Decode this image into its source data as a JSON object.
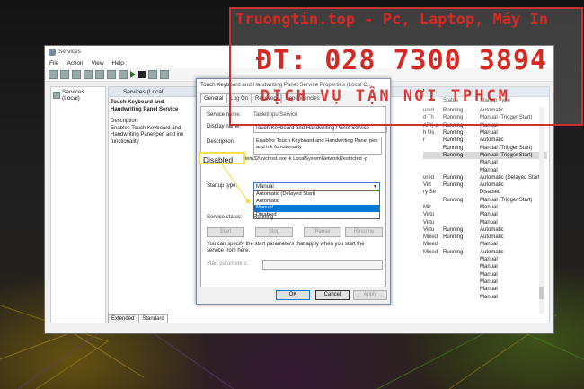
{
  "window": {
    "title": "Services",
    "menu": [
      "File",
      "Action",
      "View",
      "Help"
    ]
  },
  "tree": {
    "root": "Services (Local)"
  },
  "panel": {
    "header": "Services (Local)",
    "service_title": "Touch Keyboard and Handwriting Panel Service",
    "description_label": "Description:",
    "description_text": "Enables Touch Keyboard and Handwriting Panel pen and ink functionality"
  },
  "list": {
    "columns": {
      "status": "Status",
      "startup": "Startup Type"
    },
    "rows": [
      {
        "prefix": "",
        "status": "Running",
        "startup": "Automatic"
      },
      {
        "prefix": "",
        "status": "Running",
        "startup": "Manual (Trigger Start)"
      },
      {
        "prefix": "",
        "status": "Running",
        "startup": "Manual"
      },
      {
        "prefix": "",
        "status": "Running",
        "startup": "Manual"
      },
      {
        "prefix": "",
        "status": "Running",
        "startup": "Automatic"
      },
      {
        "prefix": "",
        "status": "Running",
        "startup": "Manual (Trigger Start)"
      },
      {
        "prefix": "",
        "status": "Running",
        "startup": "Manual (Trigger Start)"
      },
      {
        "prefix": "",
        "status": "",
        "startup": "Manual"
      },
      {
        "prefix": "",
        "status": "",
        "startup": "Manual"
      },
      {
        "prefix": "",
        "status": "Running",
        "startup": "Automatic (Delayed Start)"
      },
      {
        "prefix": "",
        "status": "Running",
        "startup": "Automatic"
      },
      {
        "prefix": "",
        "status": "",
        "startup": "Disabled"
      },
      {
        "prefix": "",
        "status": "Running",
        "startup": "Manual (Trigger Start)"
      },
      {
        "prefix": "",
        "status": "",
        "startup": "Manual"
      },
      {
        "prefix": "",
        "status": "",
        "startup": "Manual"
      },
      {
        "prefix": "",
        "status": "",
        "startup": "Manual"
      },
      {
        "prefix": "",
        "status": "Running",
        "startup": "Automatic"
      },
      {
        "prefix": "",
        "status": "Running",
        "startup": "Automatic"
      },
      {
        "prefix": "",
        "status": "",
        "startup": "Manual"
      },
      {
        "prefix": "",
        "status": "Running",
        "startup": "Automatic"
      },
      {
        "prefix": "",
        "status": "",
        "startup": "Manual"
      },
      {
        "prefix": "",
        "status": "",
        "startup": "Manual"
      },
      {
        "prefix": "",
        "status": "",
        "startup": "Manual"
      },
      {
        "prefix": "",
        "status": "",
        "startup": "Manual"
      },
      {
        "prefix": "",
        "status": "",
        "startup": "Manual"
      },
      {
        "prefix": "",
        "status": "",
        "startup": "Manual"
      }
    ],
    "prefixes_top": [
      "ured",
      "d Th",
      "API) s",
      "h Us",
      "r",
      "",
      "",
      "",
      "",
      "ured",
      "Virt",
      "ry Se",
      "",
      "Mic",
      "Virtu",
      "Virtu",
      "Virtu",
      "Mixed",
      "Mixed",
      "Mixed",
      "",
      "",
      "",
      "",
      "",
      ""
    ]
  },
  "bottom_tabs": [
    "Extended",
    "Standard"
  ],
  "dialog": {
    "title": "Touch Keyboard and Handwriting Panel Service Properties (Local C...",
    "tabs": [
      "General",
      "Log On",
      "Recovery",
      "Dependencies"
    ],
    "service_name_label": "Service name:",
    "service_name": "TabletInputService",
    "display_name_label": "Display name:",
    "display_name": "Touch Keyboard and Handwriting Panel Service",
    "description_label": "Description:",
    "description": "Enables Touch Keyboard and Handwriting Panel pen and ink functionality",
    "path": "C:\\Wi  DOWS\\System32\\svchost.exe -k LocalSystemNetworkRestricted -p",
    "startup_label": "Startup type:",
    "startup_value": "Manual",
    "startup_options": [
      "Automatic (Delayed Start)",
      "Automatic",
      "Manual",
      "Disabled"
    ],
    "startup_highlighted": "Manual",
    "status_label": "Service status:",
    "status_value": "Running",
    "buttons": {
      "start": "Start",
      "stop": "Stop",
      "pause": "Pause",
      "resume": "Resume"
    },
    "hint": "You can specify the start parameters that apply when you start the service from here.",
    "params_label": "Start parameters:",
    "ok": "OK",
    "cancel": "Cancel",
    "apply": "Apply"
  },
  "callout": {
    "text": "Disabled",
    "color": "#f2e14a"
  },
  "watermark": {
    "line1": "Truongtin.top - Pc, Laptop, Máy In",
    "line2": "ĐT: 028 7300 3894",
    "line3": "DỊCH VỤ TẬN NƠI TPHCM",
    "color": "#d42a23"
  }
}
